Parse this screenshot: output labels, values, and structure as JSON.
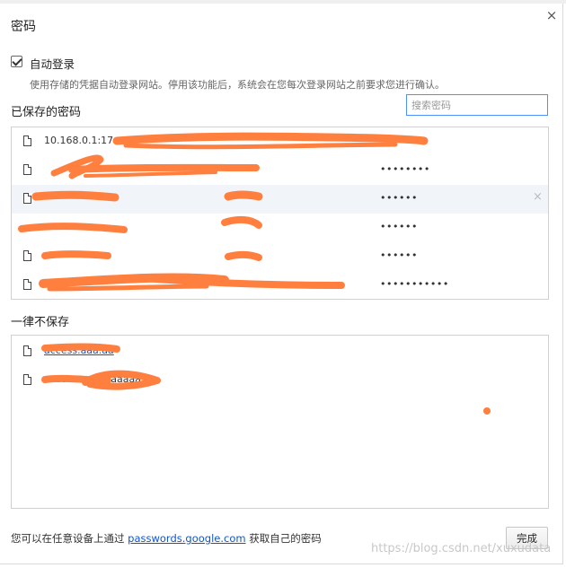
{
  "dialog": {
    "title": "密码",
    "close_glyph": "×"
  },
  "autologin": {
    "label": "自动登录",
    "checked": true,
    "description": "使用存储的凭据自动登录网站。停用该功能后，系统会在您每次登录网站之前要求您进行确认。"
  },
  "saved": {
    "heading": "已保存的密码",
    "search_placeholder": "搜索密码",
    "rows": [
      {
        "site": "10.168.0.1:17",
        "user": "",
        "password": ""
      },
      {
        "site": "",
        "user": "",
        "password": "••••••••"
      },
      {
        "site": "",
        "user": "",
        "password": "••••••",
        "delete_glyph": "×"
      },
      {
        "site": "",
        "user": "",
        "password": "••••••"
      },
      {
        "site": "",
        "user": "",
        "password": "••••••"
      },
      {
        "site": "",
        "user": "",
        "password": "•••••••••••"
      }
    ]
  },
  "never": {
    "heading": "一律不保存",
    "rows": [
      {
        "site": "access.aaa.aa"
      },
      {
        "site": "account.aaaaaaaaa.aa"
      }
    ]
  },
  "footer": {
    "text_before": "您可以在任意设备上通过",
    "link": "passwords.google.com",
    "text_after": "获取自己的密码",
    "done_label": "完成"
  },
  "watermark": "https://blog.csdn.net/xuxudata",
  "colors": {
    "redaction": "#ff7f3f",
    "link": "#1155cc",
    "focus": "#4d90fe",
    "highlight_row": "#f1f4f9"
  }
}
